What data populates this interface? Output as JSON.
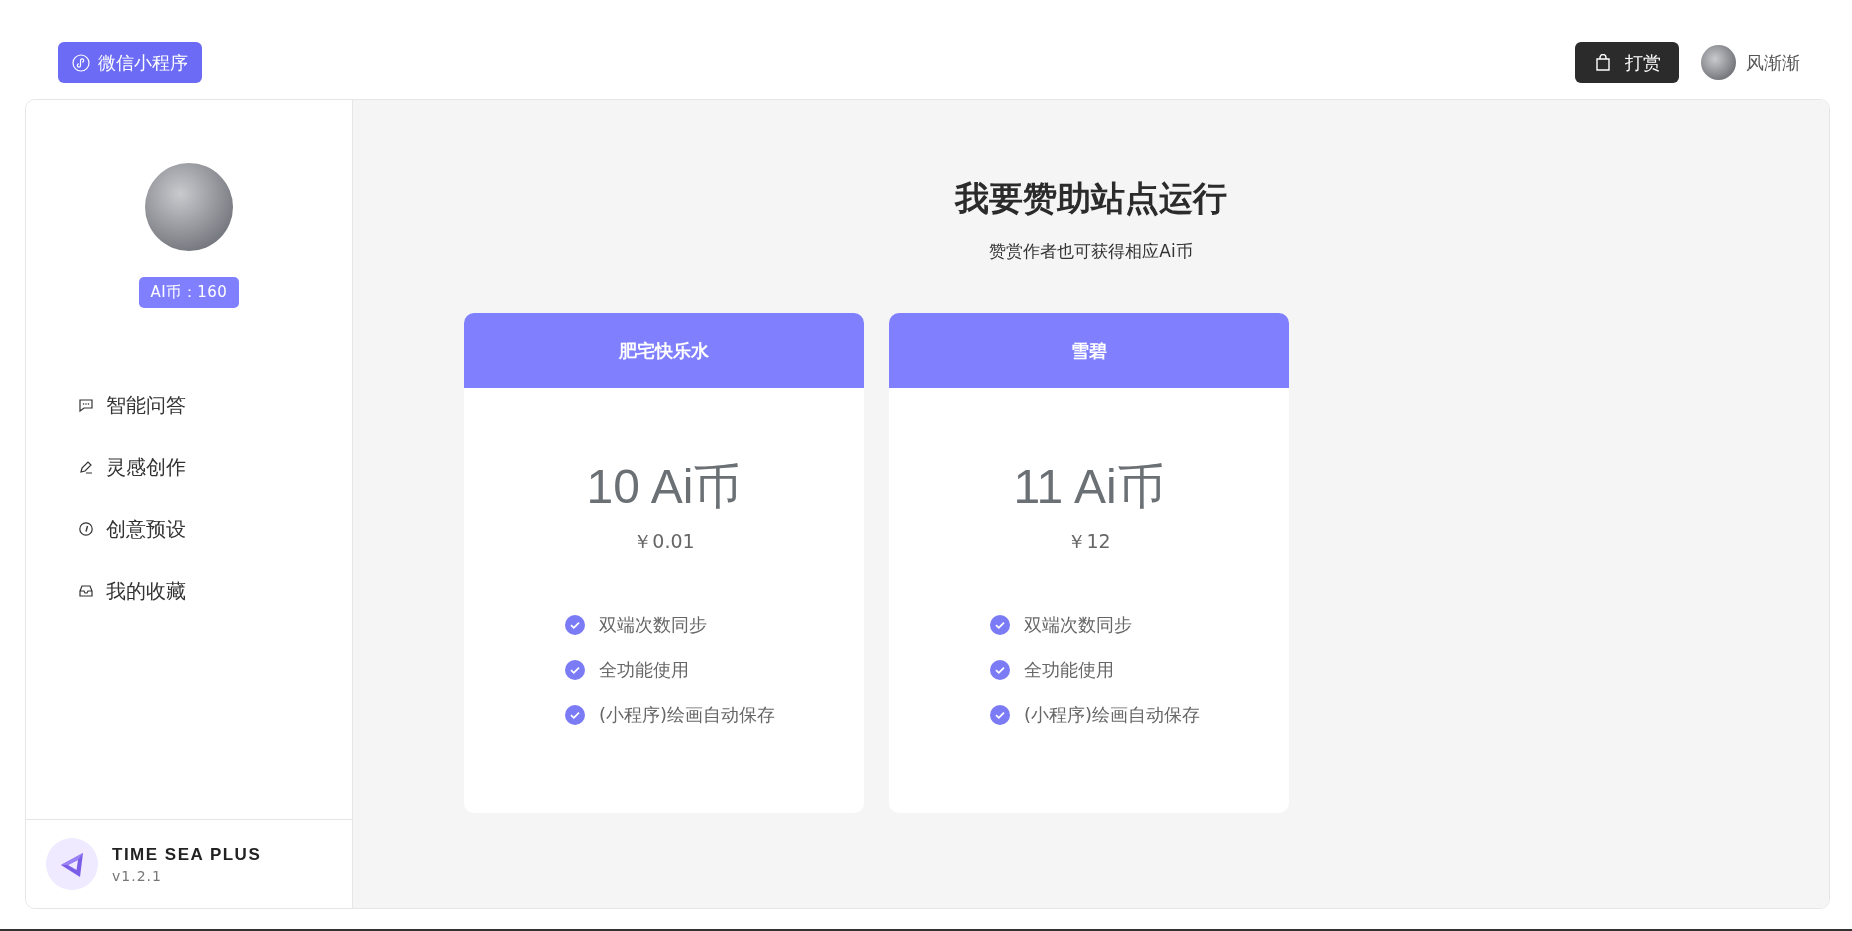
{
  "header": {
    "mini_program_button": "微信小程序",
    "tip_button": "打赏",
    "user_name": "风渐渐"
  },
  "sidebar": {
    "coins_badge": "AI币：160",
    "menu": [
      {
        "label": "智能问答"
      },
      {
        "label": "灵感创作"
      },
      {
        "label": "创意预设"
      },
      {
        "label": "我的收藏"
      }
    ],
    "footer": {
      "app_name": "TIME SEA PLUS",
      "version": "v1.2.1"
    }
  },
  "main": {
    "title": "我要赞助站点运行",
    "subtitle": "赞赏作者也可获得相应Ai币",
    "plans": [
      {
        "name": "肥宅快乐水",
        "amount": "10 Ai币",
        "price": "￥0.01",
        "features": [
          "双端次数同步",
          "全功能使用",
          "(小程序)绘画自动保存"
        ]
      },
      {
        "name": "雪碧",
        "amount": "11 Ai币",
        "price": "￥12",
        "features": [
          "双端次数同步",
          "全功能使用",
          "(小程序)绘画自动保存"
        ]
      }
    ]
  }
}
